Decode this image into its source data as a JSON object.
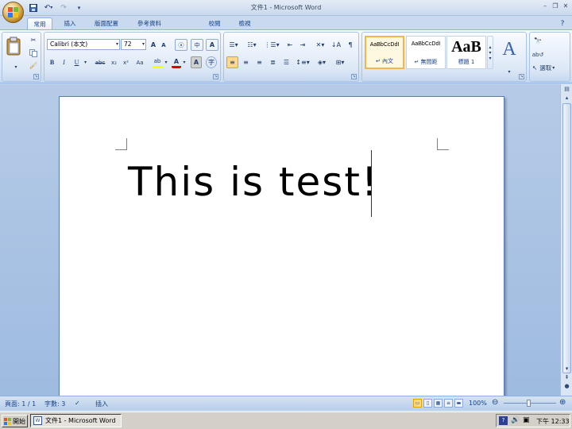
{
  "window": {
    "title": "文件1 - Microsoft Word",
    "minimize_icon": "minimize-icon",
    "restore_icon": "restore-icon",
    "close_icon": "close-icon"
  },
  "quick_access": {
    "items": [
      "save-icon",
      "undo-icon",
      "redo-icon",
      "customize-icon"
    ]
  },
  "tabs": [
    "常用",
    "插入",
    "版面配置",
    "參考資料",
    "校閱",
    "檢視"
  ],
  "active_tab": "常用",
  "ribbon": {
    "clipboard": {
      "paste_icon": "paste-icon",
      "cut_icon": "cut-icon",
      "copy_icon": "copy-icon",
      "format_painter_icon": "format-painter-icon"
    },
    "font": {
      "font_name": "Calibri (本文)",
      "font_size": "72",
      "grow_label": "A",
      "shrink_label": "A",
      "case_label": "Aa",
      "bold": "B",
      "italic": "I",
      "underline": "U",
      "strike": "abc",
      "subscript": "x₂",
      "superscript": "x²",
      "font_color": "A",
      "highlight": "ab"
    },
    "styles": [
      {
        "sample": "AaBbCcDdI",
        "name": "↵ 內文"
      },
      {
        "sample": "AaBbCcDdI",
        "name": "↵ 無間距"
      },
      {
        "sample": "AaB",
        "name": "標題 1"
      }
    ],
    "editing": {
      "find_icon": "find-icon",
      "replace_icon": "replace-icon",
      "select_label": "選取"
    }
  },
  "document": {
    "text": "This is test!"
  },
  "statusbar": {
    "page": "頁面: 1 / 1",
    "words": "字數: 3",
    "mode": "插入",
    "zoom": "100%"
  },
  "taskbar": {
    "start_label": "開始",
    "task_label": "文件1 - Microsoft Word",
    "clock": "下午 12:33"
  },
  "colors": {
    "ribbon_blue": "#c9d9ee",
    "doc_background": "#a7c1e4",
    "selected_style": "#f0b84a"
  }
}
